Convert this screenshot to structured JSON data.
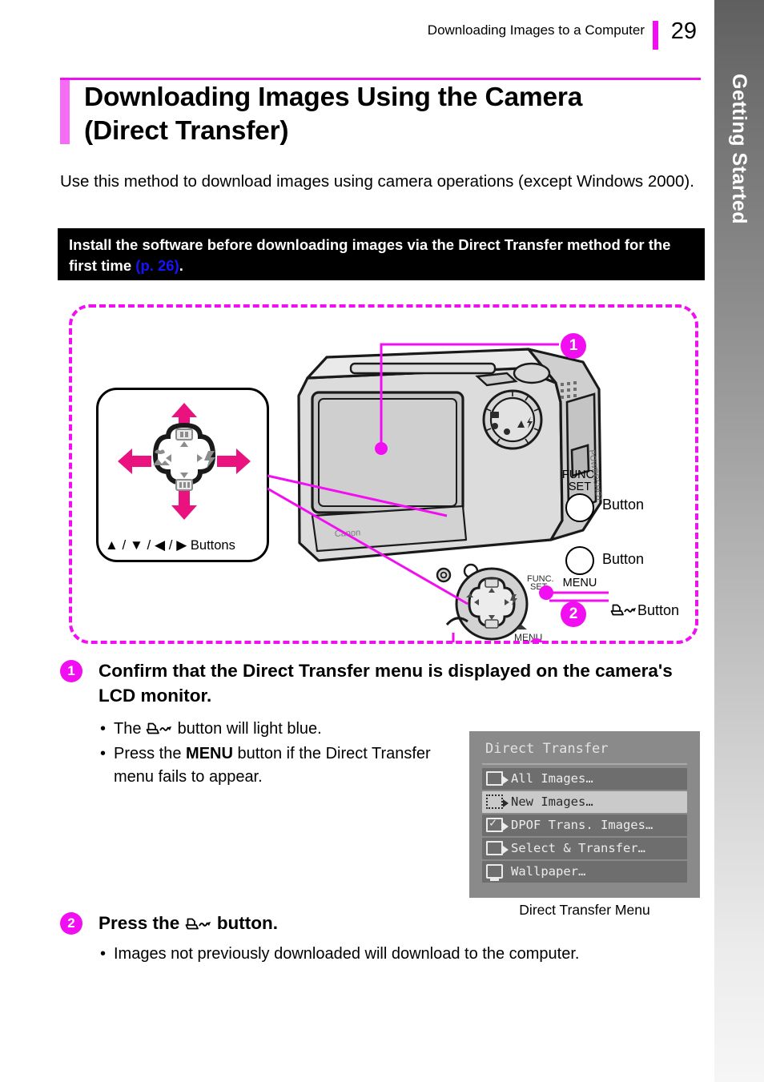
{
  "header": {
    "title": "Downloading Images to a Computer",
    "page_number": "29",
    "accent_color": "#f10ef1"
  },
  "side_tab": {
    "label": "Getting Started"
  },
  "heading": {
    "line1": "Downloading Images Using the Camera",
    "line2": "(Direct Transfer)"
  },
  "intro": {
    "text": "Use this method to download images using camera operations (except Windows 2000)."
  },
  "notice": {
    "text_before": "Install the software before downloading images via the Direct Transfer method for the first time ",
    "link": "(p. 26)",
    "text_after": ".",
    "background": "#000000",
    "link_color": "#1414ff"
  },
  "diagram": {
    "controller_caption_symbols": "▲ / ▼ / ◀ / ▶",
    "controller_caption_text": "Buttons",
    "badge_1": "1",
    "badge_2": "2",
    "labels": {
      "func_set_top": "FUNC.",
      "func_set_bottom": "SET",
      "func_set_button": "Button",
      "menu_label": "MENU",
      "menu_button": "Button",
      "print_button": "Button"
    }
  },
  "steps": [
    {
      "number": "1",
      "heading": "Confirm that the Direct Transfer menu is displayed on the camera's LCD monitor.",
      "bullets": [
        {
          "before": "The ",
          "icon": "print-share-icon",
          "after": " button will light blue."
        },
        {
          "before": "Press the ",
          "bold": "MENU",
          "after": " button if the Direct Transfer menu fails to appear."
        }
      ]
    },
    {
      "number": "2",
      "heading_before": "Press the ",
      "heading_icon": "print-share-icon",
      "heading_after": " button.",
      "bullets": [
        {
          "before": "Images not previously downloaded will download to the computer."
        }
      ]
    }
  ],
  "lcd": {
    "title": "Direct Transfer",
    "caption": "Direct Transfer Menu",
    "background": "#8a8a8a",
    "row_color": "#6e6e6e",
    "selected_color": "#cacaca",
    "items": [
      {
        "label": "All Images…",
        "icon": "stack-transfer-icon",
        "selected": false
      },
      {
        "label": "New Images…",
        "icon": "new-transfer-icon",
        "selected": true
      },
      {
        "label": "DPOF Trans. Images…",
        "icon": "check-transfer-icon",
        "selected": false
      },
      {
        "label": "Select & Transfer…",
        "icon": "single-transfer-icon",
        "selected": false
      },
      {
        "label": "Wallpaper…",
        "icon": "wallpaper-icon",
        "selected": false
      }
    ]
  }
}
